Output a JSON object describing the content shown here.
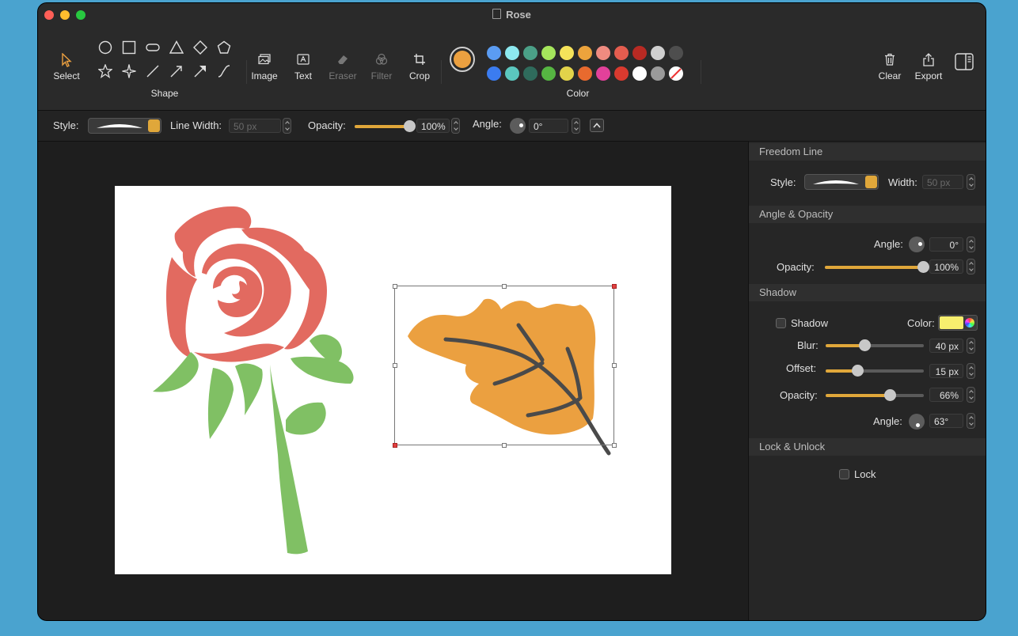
{
  "window": {
    "title": "Rose"
  },
  "toolbar": {
    "select_label": "Select",
    "shape_label": "Shape",
    "image_label": "Image",
    "text_label": "Text",
    "eraser_label": "Eraser",
    "filter_label": "Filter",
    "crop_label": "Crop",
    "color_label": "Color",
    "clear_label": "Clear",
    "export_label": "Export",
    "current_color": "#eba040",
    "swatches_row1": [
      "#5b9cf2",
      "#8de9f0",
      "#4ba087",
      "#a5e65c",
      "#f5e35a",
      "#eca33c",
      "#ef8b80",
      "#e55d4f",
      "#b82a23",
      "#cfcfcf",
      "#4e4e4e"
    ],
    "swatches_row2": [
      "#3b7cf0",
      "#5bc7bf",
      "#2f6b5c",
      "#56b642",
      "#e2d34a",
      "#e86a2e",
      "#e2419a",
      "#d93a2f",
      "#ffffff",
      "#9a9a9a",
      "none"
    ]
  },
  "options": {
    "style_label": "Style:",
    "line_width_label": "Line Width:",
    "line_width_value": "50 px",
    "opacity_label": "Opacity:",
    "opacity_value": "100%",
    "opacity_level": 1.0,
    "angle_label": "Angle:",
    "angle_value": "0°"
  },
  "sidebar": {
    "freedom": {
      "header": "Freedom Line",
      "style_label": "Style:",
      "width_label": "Width:",
      "width_value": "50 px"
    },
    "angle_opacity": {
      "header": "Angle & Opacity",
      "angle_label": "Angle:",
      "angle_value": "0°",
      "opacity_label": "Opacity:",
      "opacity_value": "100%",
      "opacity_level": 1.0
    },
    "shadow": {
      "header": "Shadow",
      "shadow_label": "Shadow",
      "color_label": "Color:",
      "color": "#f7ef6e",
      "blur_label": "Blur:",
      "blur_value": "40 px",
      "blur_level": 0.4,
      "offset_label": "Offset:",
      "offset_value": "15 px",
      "offset_level": 0.33,
      "opacity_label": "Opacity:",
      "opacity_value": "66%",
      "opacity_level": 0.66,
      "angle_label": "Angle:",
      "angle_value": "63°"
    },
    "lock": {
      "header": "Lock & Unlock",
      "lock_label": "Lock"
    }
  }
}
